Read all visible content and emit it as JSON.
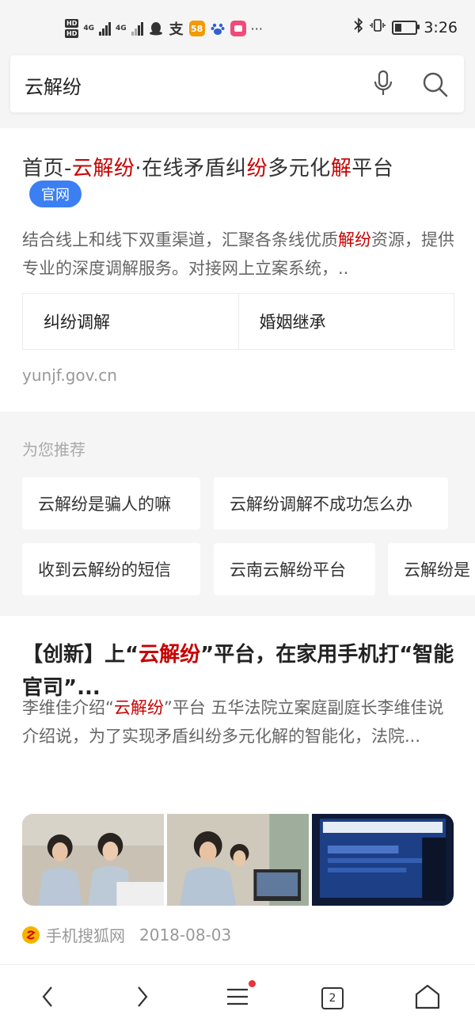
{
  "status_bar": {
    "hd1": "HD",
    "hd2": "HD",
    "net1": "4G",
    "net2": "4G",
    "apps": [
      "qq-icon",
      "alipay-icon",
      "58-icon",
      "baidu-icon",
      "app-icon"
    ],
    "app58": "58",
    "more": "···",
    "time": "3:26"
  },
  "search": {
    "query": "云解纷"
  },
  "result1": {
    "title_parts": [
      "首页-",
      "云解纷",
      "·在线矛盾纠",
      "纷",
      "多元化",
      "解",
      "平台"
    ],
    "badge": "官网",
    "desc_parts": [
      "结合线上和线下双重渠道，汇聚各条线优质",
      "解纷",
      "资源，提供专业的深度调解服务。对接网上立案系统，.."
    ],
    "sublinks": [
      "纠纷调解",
      "婚姻继承"
    ],
    "url": "yunjf.gov.cn"
  },
  "recommend": {
    "heading": "为您推荐",
    "chips": [
      "云解纷是骗人的嘛",
      "云解纷调解不成功怎么办",
      "收到云解纷的短信",
      "云南云解纷平台",
      "云解纷是"
    ]
  },
  "result2": {
    "title_parts": [
      "【创新】上“",
      "云解纷",
      "”平台，在家用手机打“智能官司”..."
    ],
    "desc_parts": [
      "李维佳介绍“",
      "云解纷",
      "”平台 五华法院立案庭副庭长李维佳说介绍说，为了实现矛盾纠纷多元化解的智能化，法院..."
    ],
    "source": "手机搜狐网",
    "date": "2018-08-03"
  },
  "nav": {
    "tab_count": "2",
    "icons": [
      "back-icon",
      "forward-icon",
      "menu-icon",
      "tabs-icon",
      "home-icon"
    ]
  },
  "colors": {
    "highlight": "#c80000",
    "badge_blue": "#3b7ff3",
    "notification_dot": "#e8343a"
  }
}
